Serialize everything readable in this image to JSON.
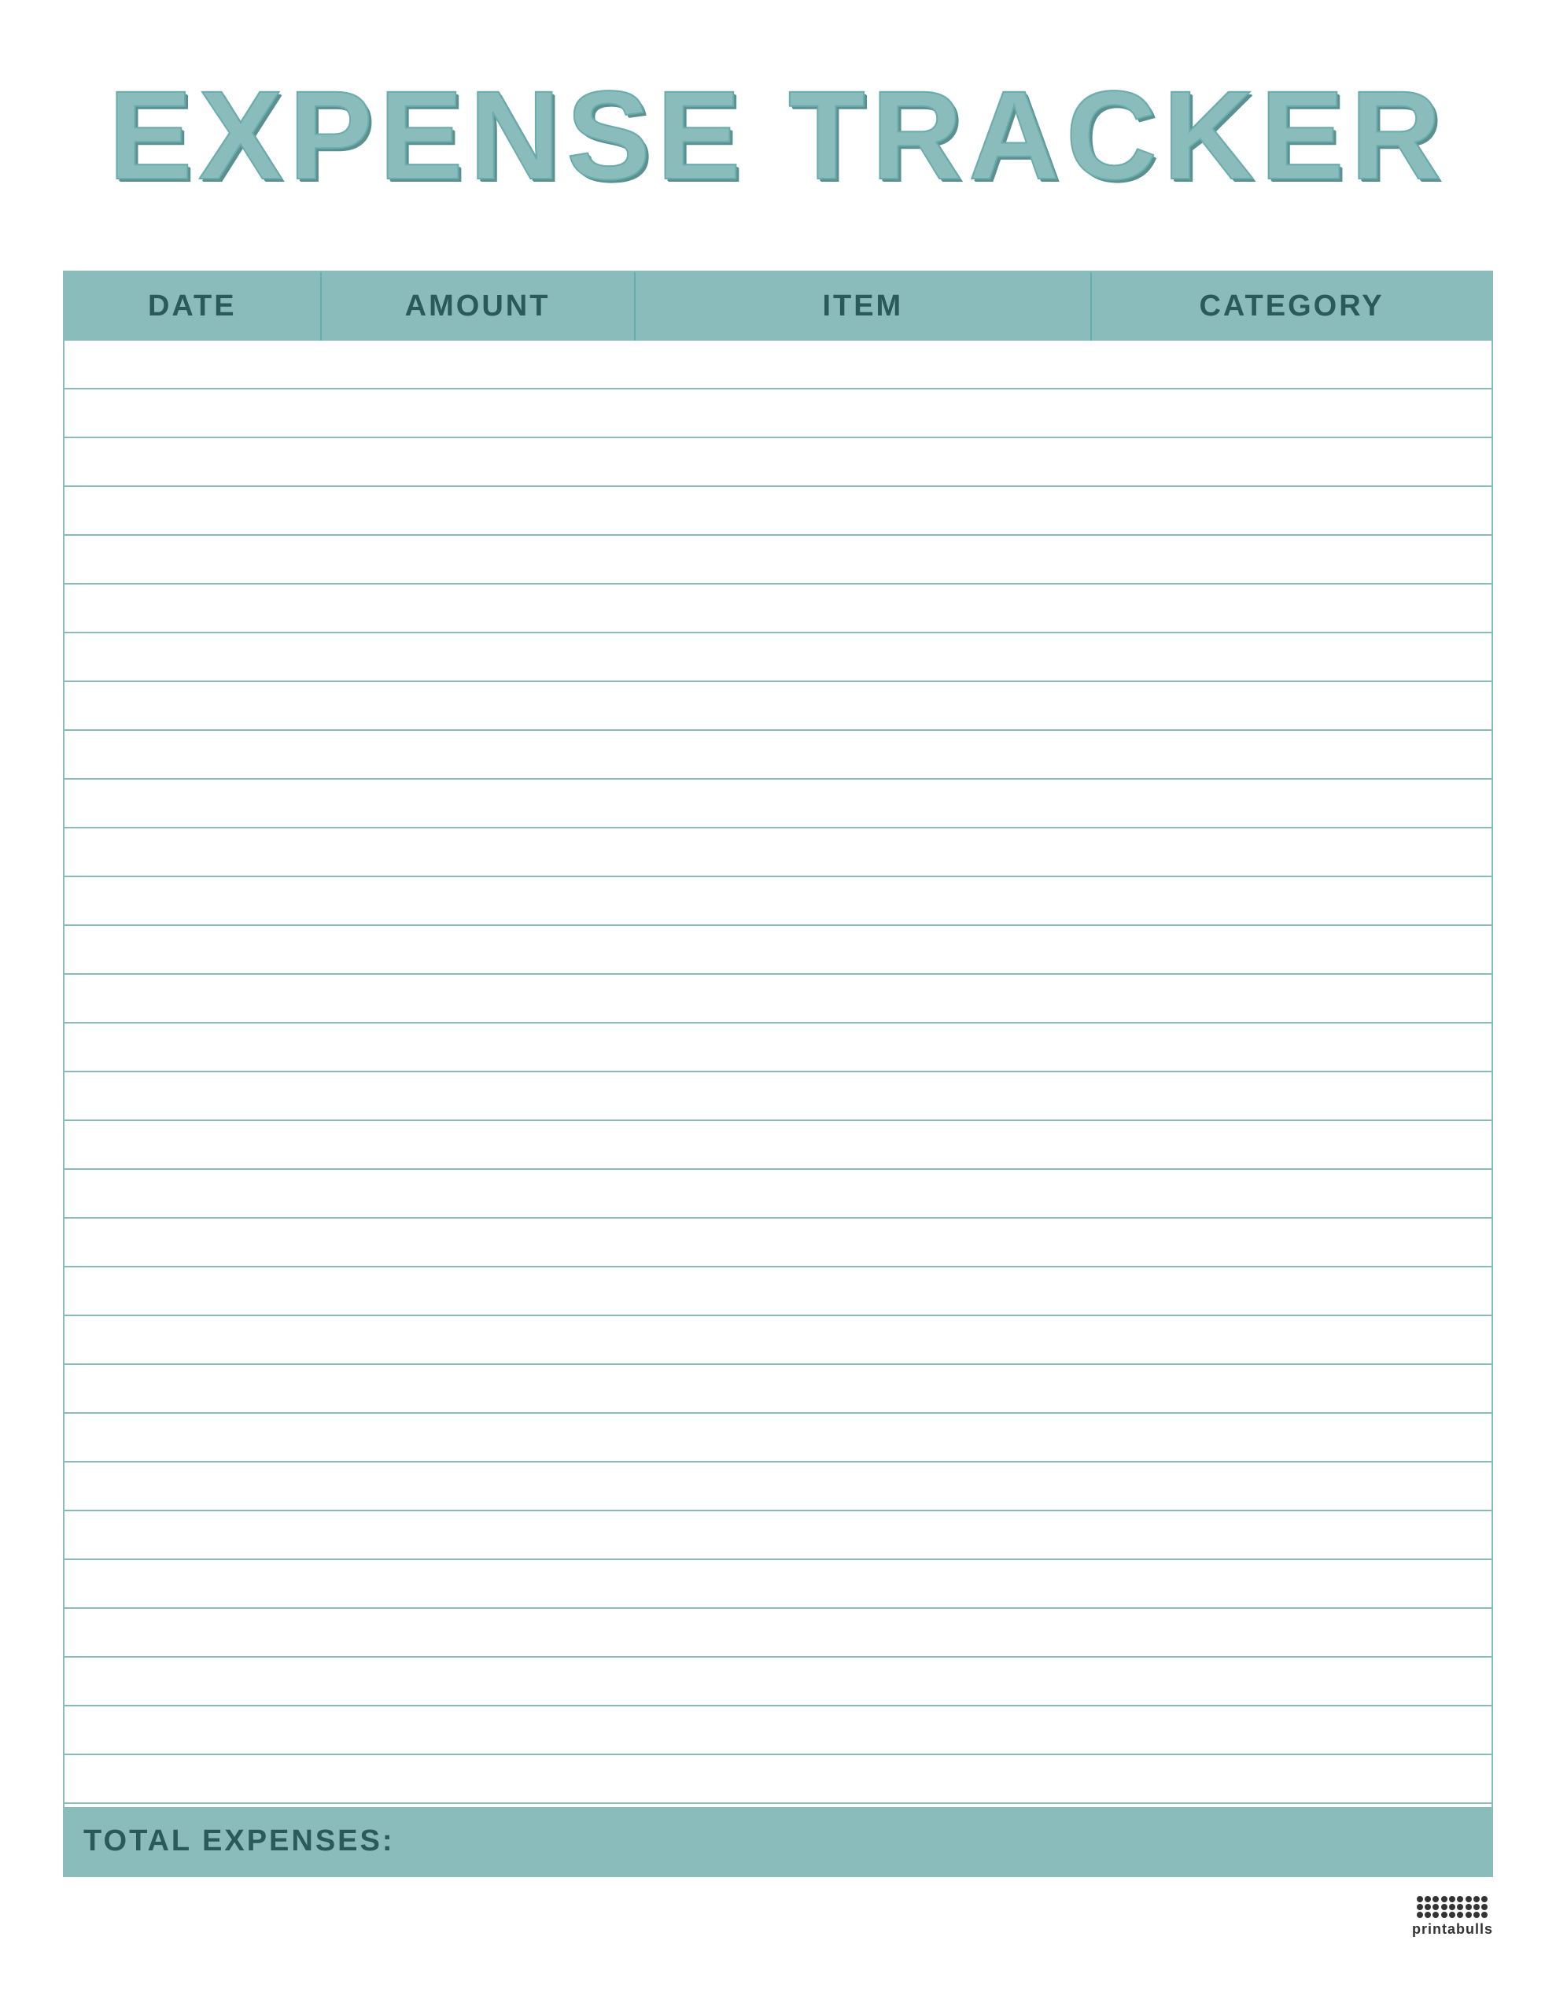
{
  "title": "EXPENSE TRACKER",
  "header": {
    "columns": [
      "DATE",
      "AMOUNT",
      "ITEM",
      "CATEGORY"
    ]
  },
  "rows": 30,
  "footer": {
    "label": "TOTAL EXPENSES:"
  },
  "watermark": {
    "text": "printabulls",
    "icon": "printabulls-icon"
  },
  "colors": {
    "accent": "#8bbcbc",
    "header_text": "#2a5a5a",
    "line": "#8bbcbc",
    "background": "#ffffff"
  }
}
